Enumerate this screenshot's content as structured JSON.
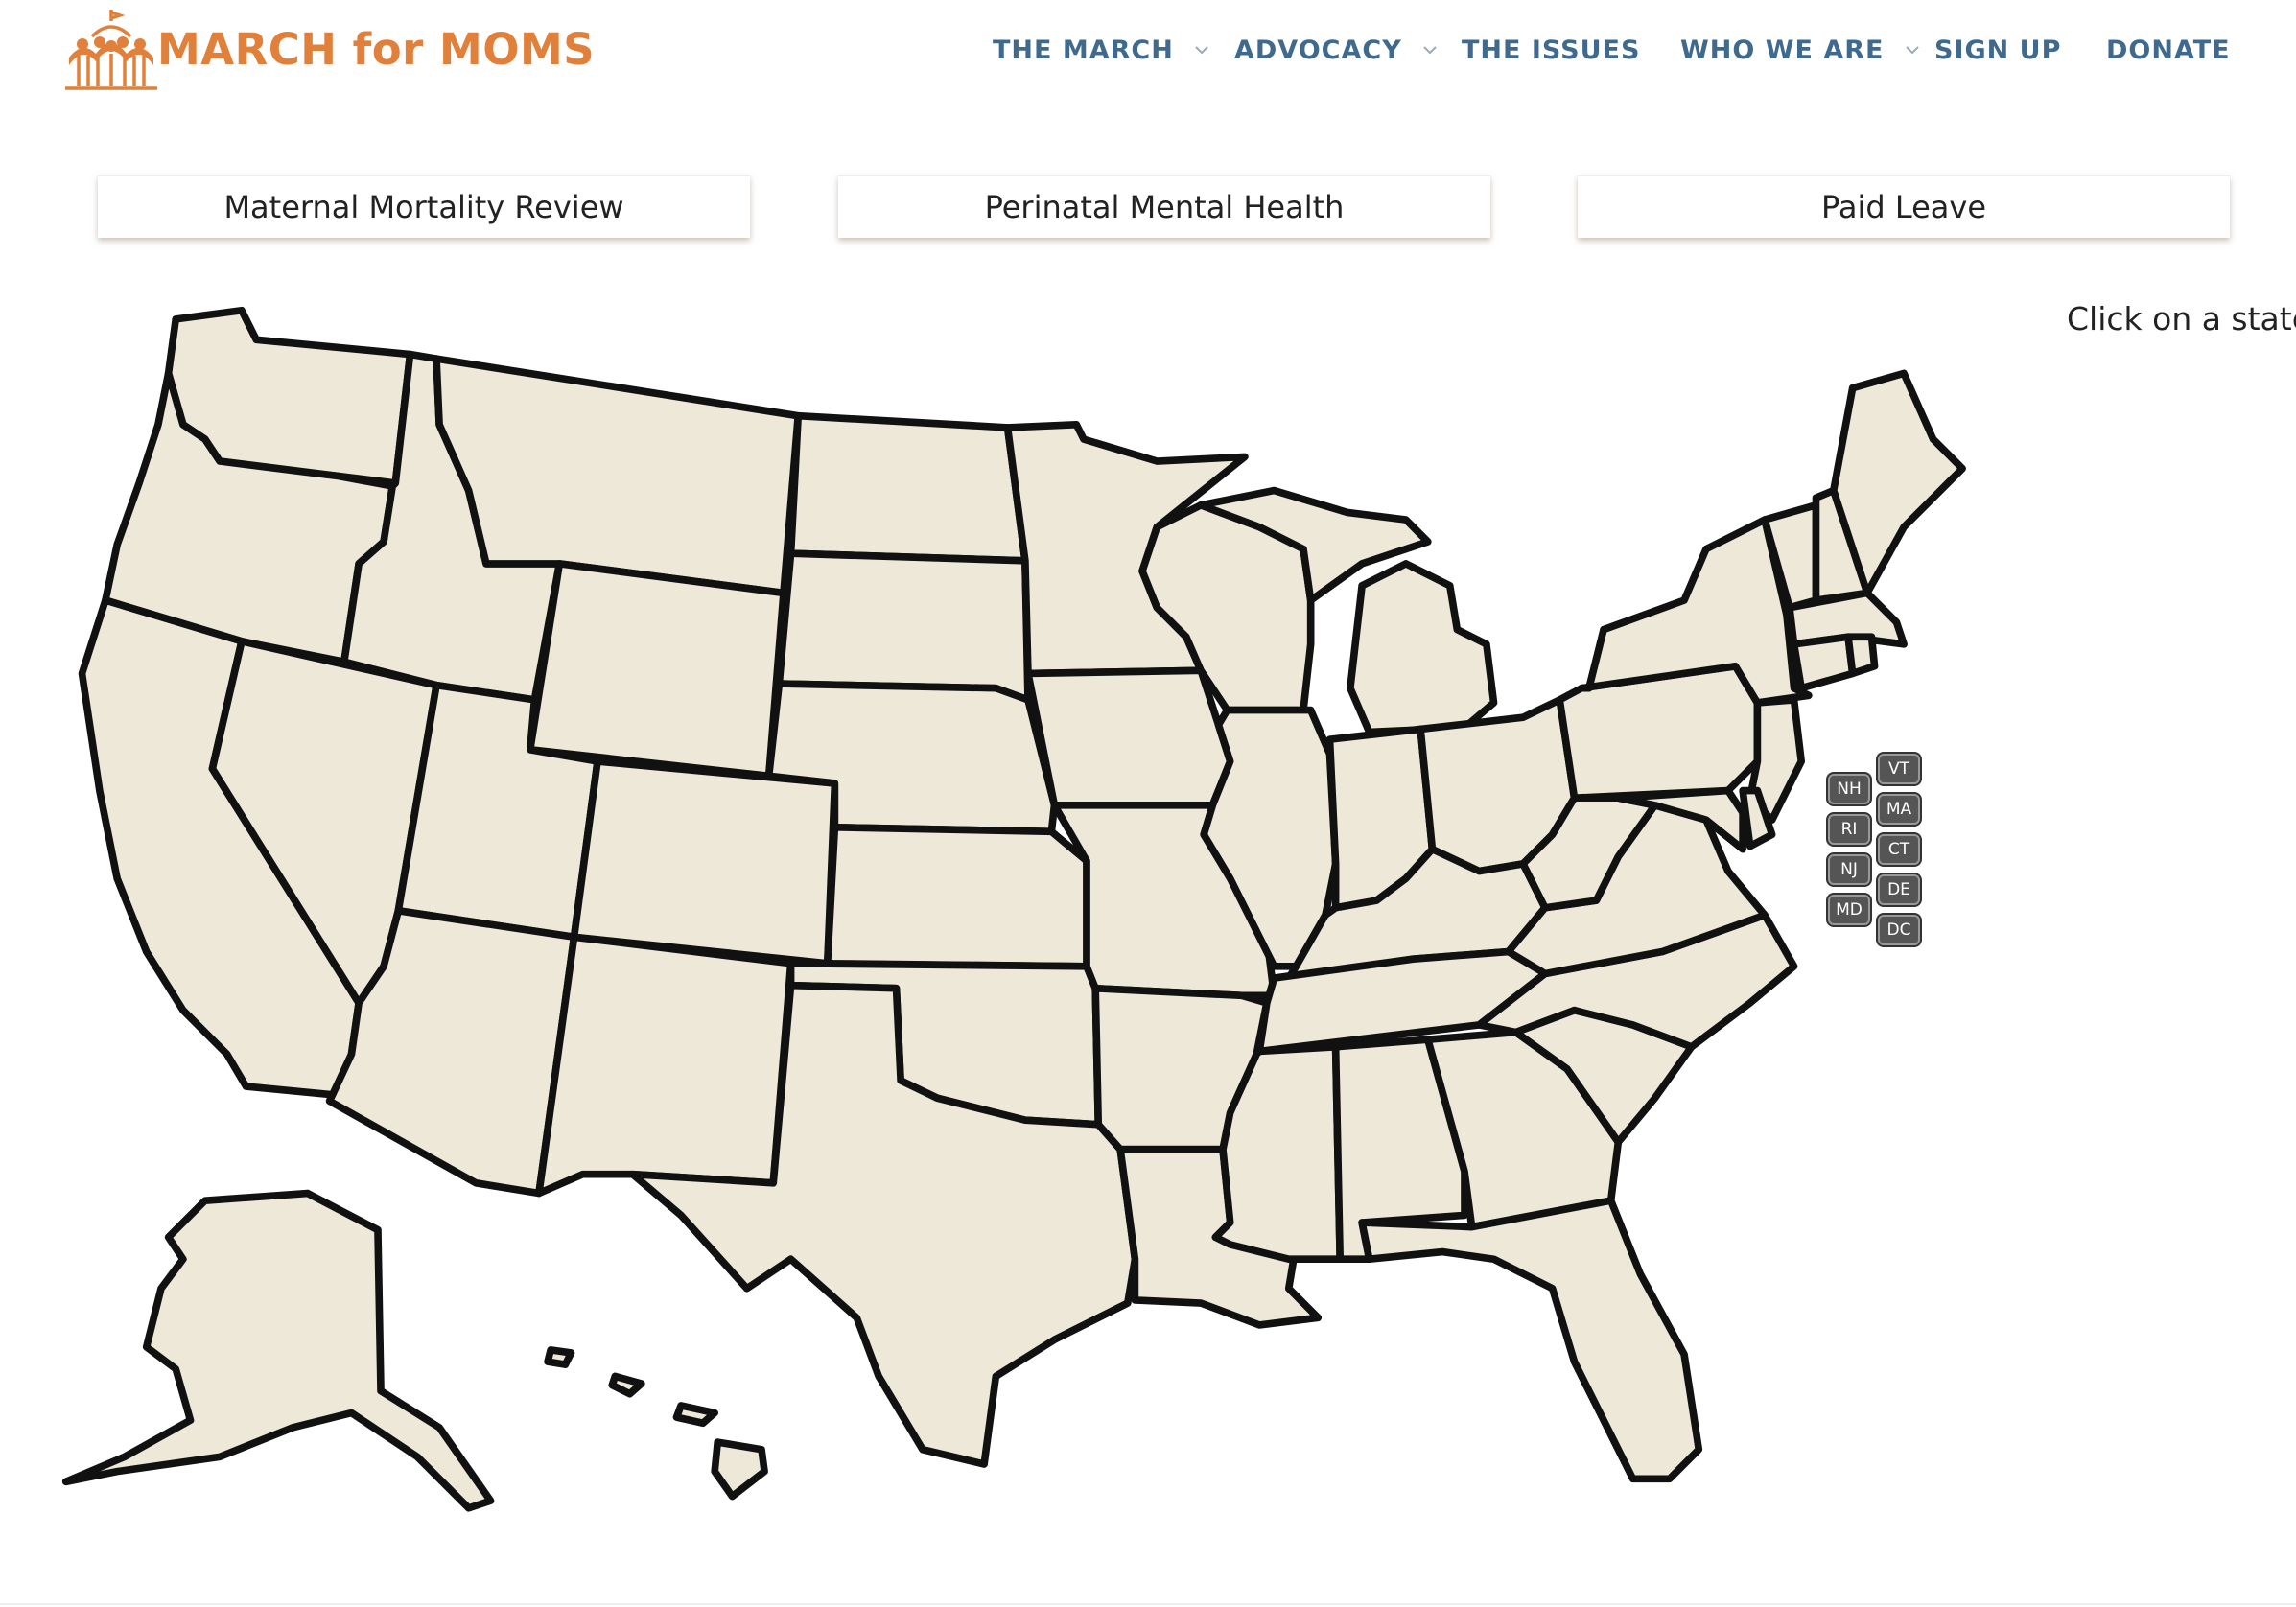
{
  "brand": {
    "name": "MARCH for MOMS",
    "color": "#e0803a"
  },
  "nav": {
    "color": "#3f6a8e",
    "items": [
      {
        "label": "THE MARCH",
        "dropdown": true
      },
      {
        "label": "ADVOCACY",
        "dropdown": true
      },
      {
        "label": "THE ISSUES",
        "dropdown": false
      },
      {
        "label": "WHO WE ARE",
        "dropdown": true
      },
      {
        "label": "SIGN UP",
        "dropdown": false
      },
      {
        "label": "DONATE",
        "dropdown": false
      }
    ]
  },
  "tabs": [
    {
      "label": "Maternal Mortality Review"
    },
    {
      "label": "Perinatal Mental Health"
    },
    {
      "label": "Paid Leave"
    }
  ],
  "map": {
    "hint": "Click on a state",
    "fill_color": "#ede8d8",
    "badges": [
      "VT",
      "NH",
      "MA",
      "RI",
      "CT",
      "NJ",
      "DE",
      "MD",
      "DC"
    ]
  }
}
